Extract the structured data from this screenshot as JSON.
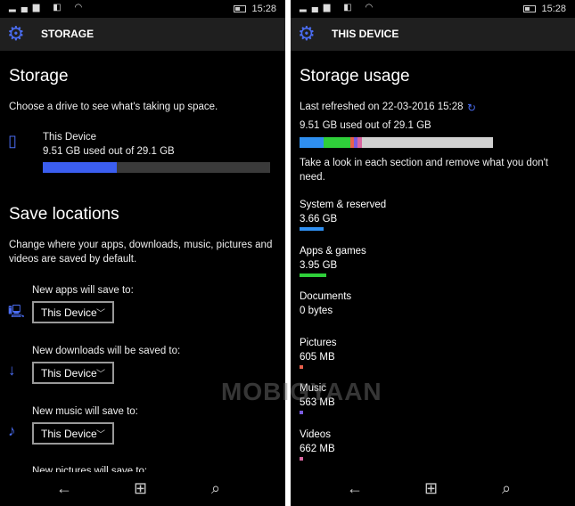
{
  "status": {
    "time": "15:28"
  },
  "left": {
    "header_title": "STORAGE",
    "title": "Storage",
    "subtitle": "Choose a drive to see what's taking up space.",
    "drive": {
      "name": "This Device",
      "usage": "9.51 GB used out of 29.1 GB",
      "used_fraction": 0.327
    },
    "save_title": "Save locations",
    "save_desc": "Change where your apps, downloads, music, pictures and videos are saved by default.",
    "locations": [
      {
        "label": "New apps will save to:",
        "value": "This Device",
        "icon": "monitor-icon"
      },
      {
        "label": "New downloads will be saved to:",
        "value": "This Device",
        "icon": "download-arrow-icon"
      },
      {
        "label": "New music will save to:",
        "value": "This Device",
        "icon": "music-note-icon"
      },
      {
        "label": "New pictures will save to:"
      }
    ]
  },
  "right": {
    "header_title": "THIS DEVICE",
    "title": "Storage usage",
    "refreshed": "Last refreshed on 22-03-2016 15:28",
    "usage": "9.51 GB used out of 29.1 GB",
    "hint": "Take a look in each section and remove what you don't need.",
    "categories": [
      {
        "name": "System & reserved",
        "size": "3.66 GB",
        "color": "#2f8ff0",
        "gb": 3.66
      },
      {
        "name": "Apps & games",
        "size": "3.95 GB",
        "color": "#2fcf3a",
        "gb": 3.95
      },
      {
        "name": "Documents",
        "size": "0 bytes",
        "color": "#000000",
        "gb": 0
      },
      {
        "name": "Pictures",
        "size": "605 MB",
        "color": "#e8604c",
        "gb": 0.605
      },
      {
        "name": "Music",
        "size": "563 MB",
        "color": "#7a5ce0",
        "gb": 0.563
      },
      {
        "name": "Videos",
        "size": "662 MB",
        "color": "#d866a0",
        "gb": 0.662
      }
    ],
    "total_gb": 29.1
  },
  "watermark": "MOBIGYAAN"
}
